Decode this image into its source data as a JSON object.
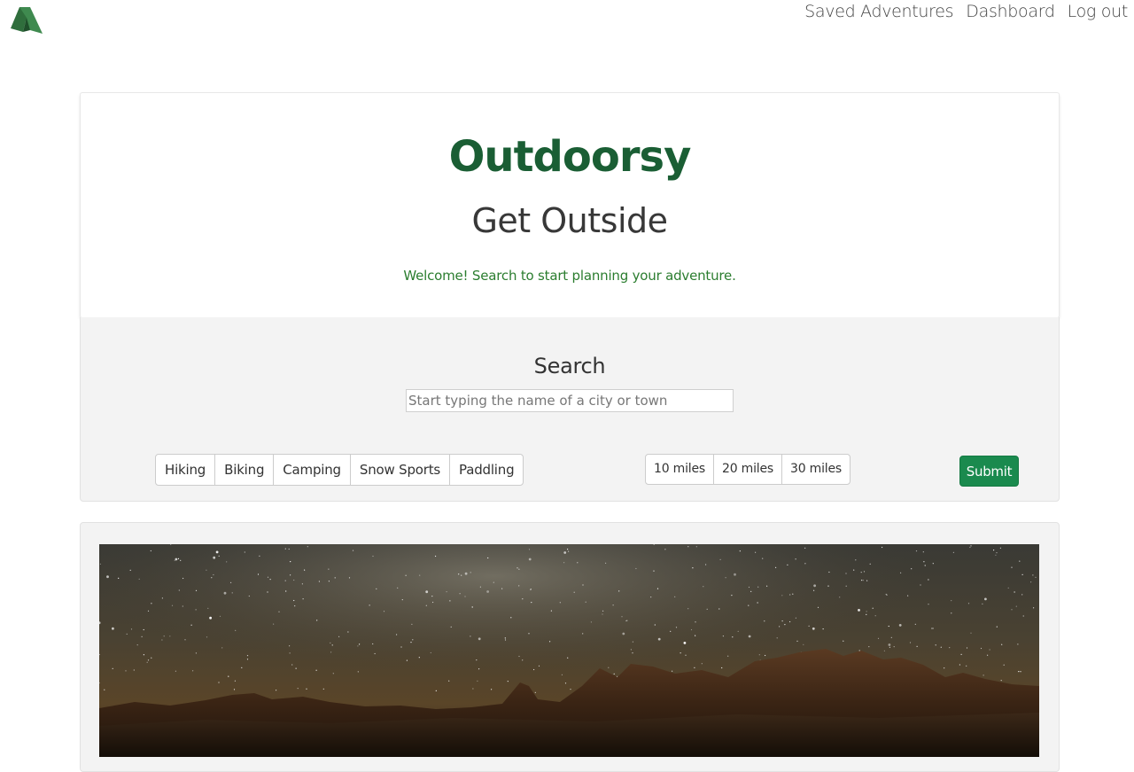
{
  "nav": {
    "logo_icon": "tent-icon",
    "links": [
      "Saved Adventures",
      "Dashboard",
      "Log out"
    ]
  },
  "hero": {
    "title": "Outdoorsy",
    "subtitle": "Get Outside",
    "welcome": "Welcome! Search to start planning your adventure."
  },
  "search": {
    "title": "Search",
    "placeholder": "Start typing the name of a city or town",
    "activities": [
      "Hiking",
      "Biking",
      "Camping",
      "Snow Sports",
      "Paddling"
    ],
    "distances": [
      "10 miles",
      "20 miles",
      "30 miles"
    ],
    "submit_label": "Submit"
  },
  "colors": {
    "brand_green": "#1a5e34",
    "welcome_green": "#2b7d2f",
    "submit_green": "#1a8a4e"
  },
  "image": {
    "subject": "night-sky-desert-landscape"
  }
}
